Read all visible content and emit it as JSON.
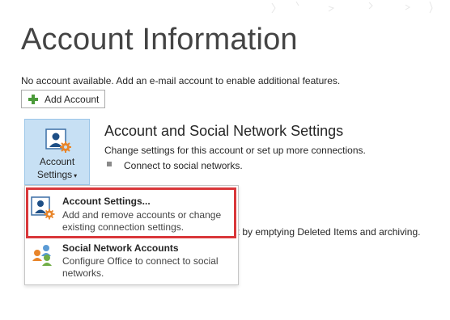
{
  "page": {
    "title": "Account Information",
    "subtitle": "No account available. Add an e-mail account to enable additional features."
  },
  "add_account": {
    "label": "Add Account",
    "icon": "plus-icon"
  },
  "account_settings_tile": {
    "line1": "Account",
    "line2": "Settings",
    "caret": "▾",
    "icon": "account-gear-icon"
  },
  "section": {
    "heading": "Account and Social Network Settings",
    "description": "Change settings for this account or set up more connections.",
    "bullet": "Connect to social networks."
  },
  "partially_hidden_text": "x by emptying Deleted Items and archiving.",
  "dropdown_menu": {
    "items": [
      {
        "title": "Account Settings...",
        "description": "Add and remove accounts or change existing connection settings.",
        "icon": "account-settings-icon",
        "highlighted": true
      },
      {
        "title": "Social Network Accounts",
        "description": "Configure Office to connect to social networks.",
        "icon": "social-network-icon",
        "highlighted": false
      }
    ]
  },
  "colors": {
    "tile_background": "#c7e0f4",
    "highlight_border": "#d9373a",
    "plus_green": "#4b9a3a",
    "gear_orange": "#e8852a"
  }
}
